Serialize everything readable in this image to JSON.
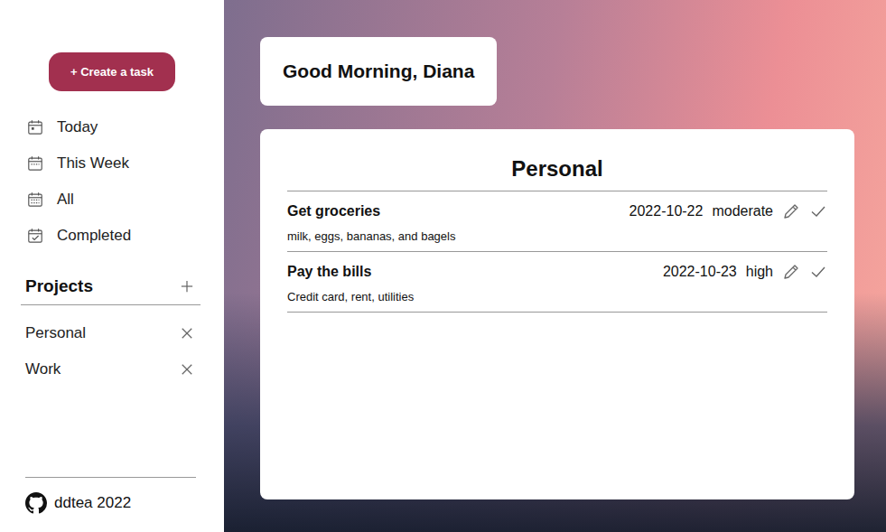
{
  "greeting": "Good Morning, Diana",
  "sidebar": {
    "create_button": "+ Create a task",
    "nav": [
      {
        "label": "Today",
        "icon": "today"
      },
      {
        "label": "This Week",
        "icon": "week"
      },
      {
        "label": "All",
        "icon": "all"
      },
      {
        "label": "Completed",
        "icon": "completed"
      }
    ],
    "projects_title": "Projects",
    "projects": [
      {
        "label": "Personal"
      },
      {
        "label": "Work"
      }
    ],
    "footer": "ddtea 2022"
  },
  "project": {
    "title": "Personal",
    "tasks": [
      {
        "title": "Get groceries",
        "description": "milk, eggs, bananas, and bagels",
        "date": "2022-10-22",
        "priority": "moderate"
      },
      {
        "title": "Pay the bills",
        "description": "Credit card, rent, utilities",
        "date": "2022-10-23",
        "priority": "high"
      }
    ]
  }
}
